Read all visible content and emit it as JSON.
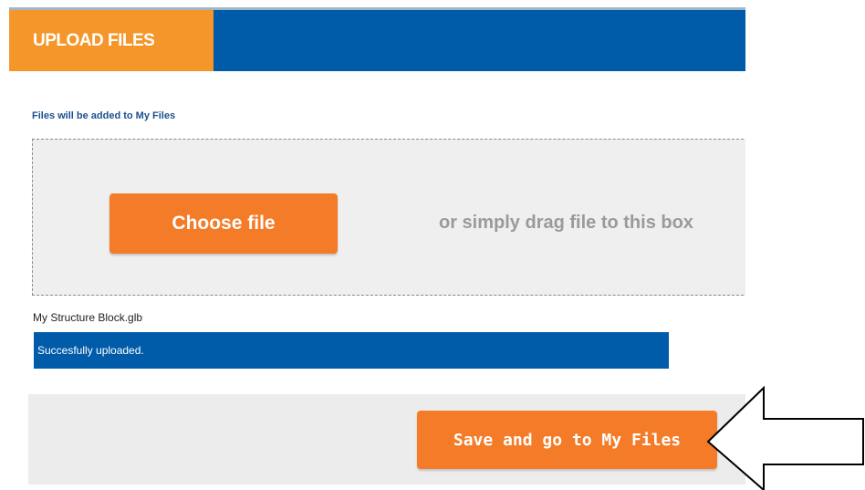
{
  "header": {
    "title": "UPLOAD FILES"
  },
  "upload": {
    "destination_note": "Files will be added to My Files",
    "choose_file_label": "Choose file",
    "drag_hint": "or simply drag file to this box"
  },
  "files": [
    {
      "name": "My Structure Block.glb",
      "status": "Succesfully uploaded."
    }
  ],
  "footer": {
    "save_label": "Save and go to My Files"
  },
  "icons": {
    "pointer": "arrow-left-icon"
  },
  "colors": {
    "brand_blue": "#005ba9",
    "tab_orange": "#f5962a",
    "button_orange": "#f47b27",
    "drop_zone_bg": "#efefef",
    "footer_bg": "#ececec"
  }
}
